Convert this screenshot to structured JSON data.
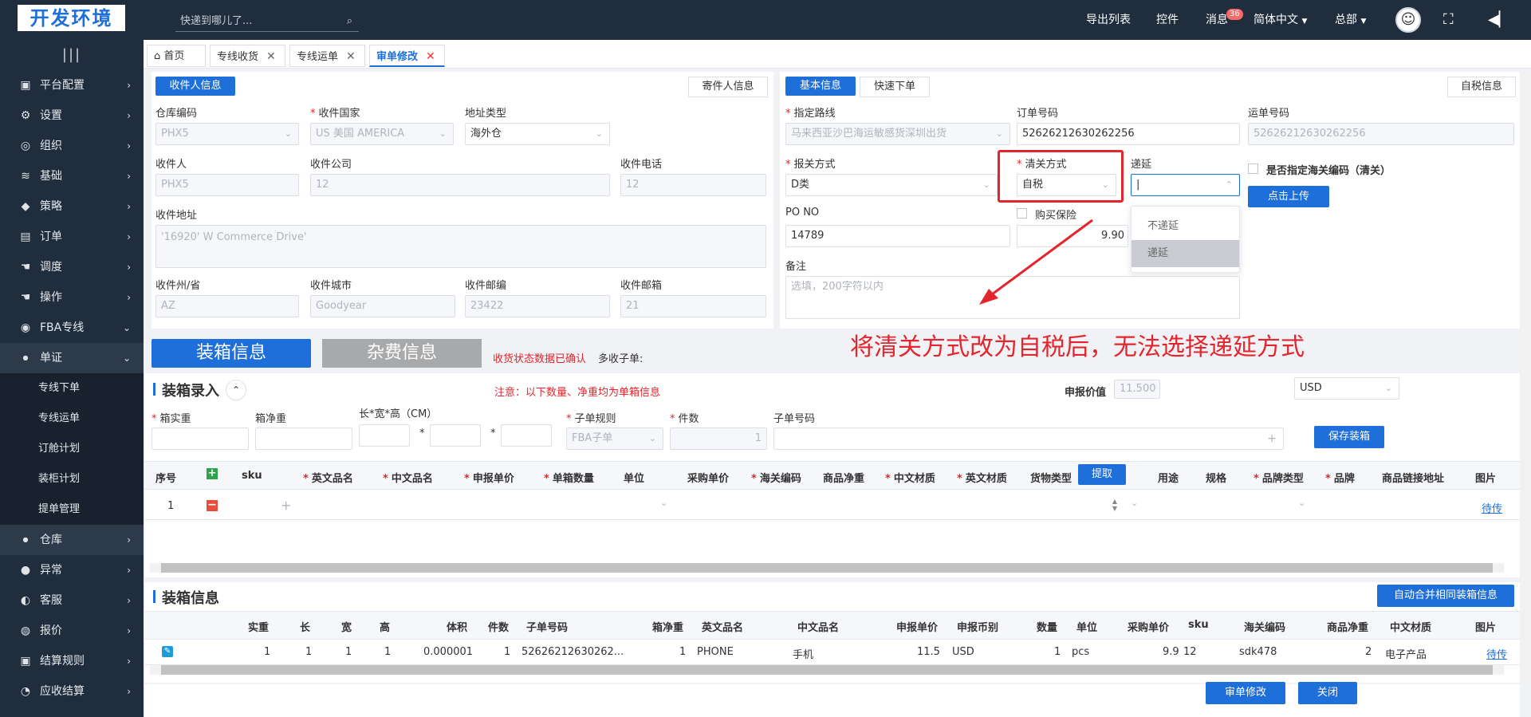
{
  "app": {
    "logo": "开发环境",
    "search_placeholder": "快递到哪儿了...",
    "nav": {
      "export_list": "导出列表",
      "controls": "控件",
      "messages": "消息",
      "messages_count": "36",
      "language": "简体中文",
      "hq": "总部"
    }
  },
  "sidebar": {
    "toggle": "|||",
    "items": [
      {
        "label": "平台配置",
        "icon": "▣"
      },
      {
        "label": "设置",
        "icon": "⚙"
      },
      {
        "label": "组织",
        "icon": "◎"
      },
      {
        "label": "基础",
        "icon": "≋"
      },
      {
        "label": "策略",
        "icon": "◆"
      },
      {
        "label": "订单",
        "icon": "▤"
      },
      {
        "label": "调度",
        "icon": "☚"
      },
      {
        "label": "操作",
        "icon": "☚"
      },
      {
        "label": "FBA专线",
        "icon": "◉"
      }
    ],
    "section": {
      "label": "单证"
    },
    "sub_items": [
      "专线下单",
      "专线运单",
      "订舱计划",
      "装柜计划",
      "提单管理"
    ],
    "warehouse": "仓库",
    "items2": [
      {
        "label": "异常",
        "icon": "●"
      },
      {
        "label": "客服",
        "icon": "◐"
      },
      {
        "label": "报价",
        "icon": "◍"
      },
      {
        "label": "结算规则",
        "icon": "▣"
      },
      {
        "label": "应收结算",
        "icon": "◔"
      }
    ]
  },
  "tabs": [
    {
      "label": "首页"
    },
    {
      "label": "专线收货"
    },
    {
      "label": "专线运单"
    },
    {
      "label": "审单修改"
    }
  ],
  "receiver": {
    "tab_active": "收件人信息",
    "tab_other": "寄件人信息",
    "warehouse_code_label": "仓库编码",
    "warehouse_code": "PHX5",
    "country_label": "收件国家",
    "country": "US 美国 AMERICA",
    "addr_type_label": "地址类型",
    "addr_type": "海外仓",
    "name_label": "收件人",
    "name": "PHX5",
    "company_label": "收件公司",
    "company": "12",
    "phone_label": "收件电话",
    "phone": "12",
    "address_label": "收件地址",
    "address": "'16920' W Commerce Drive'",
    "state_label": "收件州/省",
    "state": "AZ",
    "city_label": "收件城市",
    "city": "Goodyear",
    "zip_label": "收件邮编",
    "zip": "23422",
    "email_label": "收件邮箱",
    "email": "21"
  },
  "basic": {
    "tab_active": "基本信息",
    "tab_quick": "快速下单",
    "tab_self_tax": "自税信息",
    "route_label": "指定路线",
    "route": "马来西亚沙巴海运敏感货深圳出货",
    "order_no_label": "订单号码",
    "order_no": "52626212630262256",
    "waybill_label": "运单号码",
    "waybill": "52626212630262256",
    "declare_label": "报关方式",
    "declare": "D类",
    "clearance_label": "清关方式",
    "clearance": "自税",
    "defer_label": "递延",
    "defer_options": [
      "不递延",
      "递延"
    ],
    "customs_code_label": "是否指定海关编码（清关）",
    "upload_btn": "点击上传",
    "po_label": "PO NO",
    "po": "14789",
    "insurance_label": "购买保险",
    "insurance_value": "9.90",
    "remark_label": "备注",
    "remark_placeholder": "选填，200字符以内"
  },
  "annotation": "将清关方式改为自税后，无法选择递延方式",
  "packing_tabs": {
    "packing": "装箱信息",
    "misc": "杂费信息"
  },
  "status_text": "收货状态数据已确认",
  "multi_sub": "多收子单:",
  "entry": {
    "title": "装箱录入",
    "note": "注意：以下数量、净重均为单箱信息",
    "declared_value_label": "申报价值",
    "declared_value": "11.500",
    "currency": "USD",
    "gross_label": "箱实重",
    "net_label": "箱净重",
    "dims_label": "长*宽*高（CM）",
    "sub_rule_label": "子单规则",
    "sub_rule": "FBA子单",
    "pieces_label": "件数",
    "pieces": "1",
    "sub_no_label": "子单号码",
    "save_btn": "保存装箱",
    "extract_btn": "提取",
    "headers": [
      "序号",
      "sku",
      "英文品名",
      "中文品名",
      "申报单价",
      "单箱数量",
      "单位",
      "采购单价",
      "海关编码",
      "商品净重",
      "中文材质",
      "英文材质",
      "货物类型",
      "用途",
      "规格",
      "品牌类型",
      "品牌",
      "商品链接地址",
      "图片"
    ],
    "row_no": "1",
    "upload_link": "待传"
  },
  "packing_info": {
    "title": "装箱信息",
    "merge_btn": "自动合并相同装箱信息",
    "headers": [
      "实重",
      "长",
      "宽",
      "高",
      "体积",
      "件数",
      "子单号码",
      "箱净重",
      "英文品名",
      "中文品名",
      "申报单价",
      "申报币别",
      "数量",
      "单位",
      "采购单价",
      "sku",
      "海关编码",
      "商品净重",
      "中文材质",
      "图片"
    ],
    "row": [
      "1",
      "1",
      "1",
      "1",
      "0.000001",
      "1",
      "52626212630262...",
      "1",
      "PHONE",
      "手机",
      "11.5",
      "USD",
      "1",
      "pcs",
      "9.9",
      "12",
      "sdk478",
      "2",
      "电子产品",
      "待传"
    ]
  },
  "footer": {
    "review_btn": "审单修改",
    "close_btn": "关闭"
  },
  "colors": {
    "primary": "#1e6fd9",
    "sidebar": "#1f2d3d",
    "annotation": "#e3262d"
  }
}
